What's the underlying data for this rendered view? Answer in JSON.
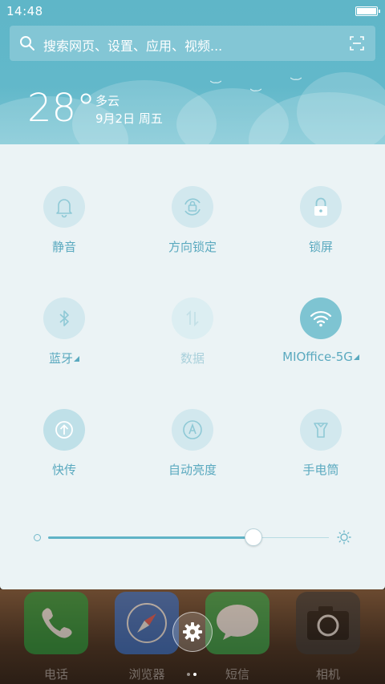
{
  "status": {
    "time": "14:48"
  },
  "search": {
    "placeholder": "搜索网页、设置、应用、视频..."
  },
  "weather": {
    "temperature": "28°",
    "condition": "多云",
    "date": "9月2日 周五"
  },
  "toggles": [
    {
      "label": "静音",
      "icon": "bell-icon",
      "state": "off"
    },
    {
      "label": "方向锁定",
      "icon": "rotation-lock-icon",
      "state": "off"
    },
    {
      "label": "锁屏",
      "icon": "lock-icon",
      "state": "off"
    },
    {
      "label": "蓝牙",
      "icon": "bluetooth-icon",
      "state": "off",
      "has_menu": true
    },
    {
      "label": "数据",
      "icon": "mobile-data-icon",
      "state": "disabled"
    },
    {
      "label": "MIOffice-5G",
      "icon": "wifi-icon",
      "state": "on",
      "has_menu": true
    },
    {
      "label": "快传",
      "icon": "share-icon",
      "state": "off"
    },
    {
      "label": "自动亮度",
      "icon": "auto-brightness-icon",
      "state": "off"
    },
    {
      "label": "手电筒",
      "icon": "flashlight-icon",
      "state": "off"
    }
  ],
  "brightness": {
    "level": 0.73
  },
  "dock": {
    "apps": [
      {
        "label": "电话",
        "icon": "phone-icon",
        "color": "#1f9b3a"
      },
      {
        "label": "浏览器",
        "icon": "compass-icon",
        "color": "#2f6fd1"
      },
      {
        "label": "短信",
        "icon": "message-icon",
        "color": "#2ea84a"
      },
      {
        "label": "相机",
        "icon": "camera-icon",
        "color": "#333333"
      }
    ]
  },
  "colors": {
    "accent": "#5aa9bf",
    "panel": "#ebf3f5",
    "header": "#62b8ca"
  }
}
